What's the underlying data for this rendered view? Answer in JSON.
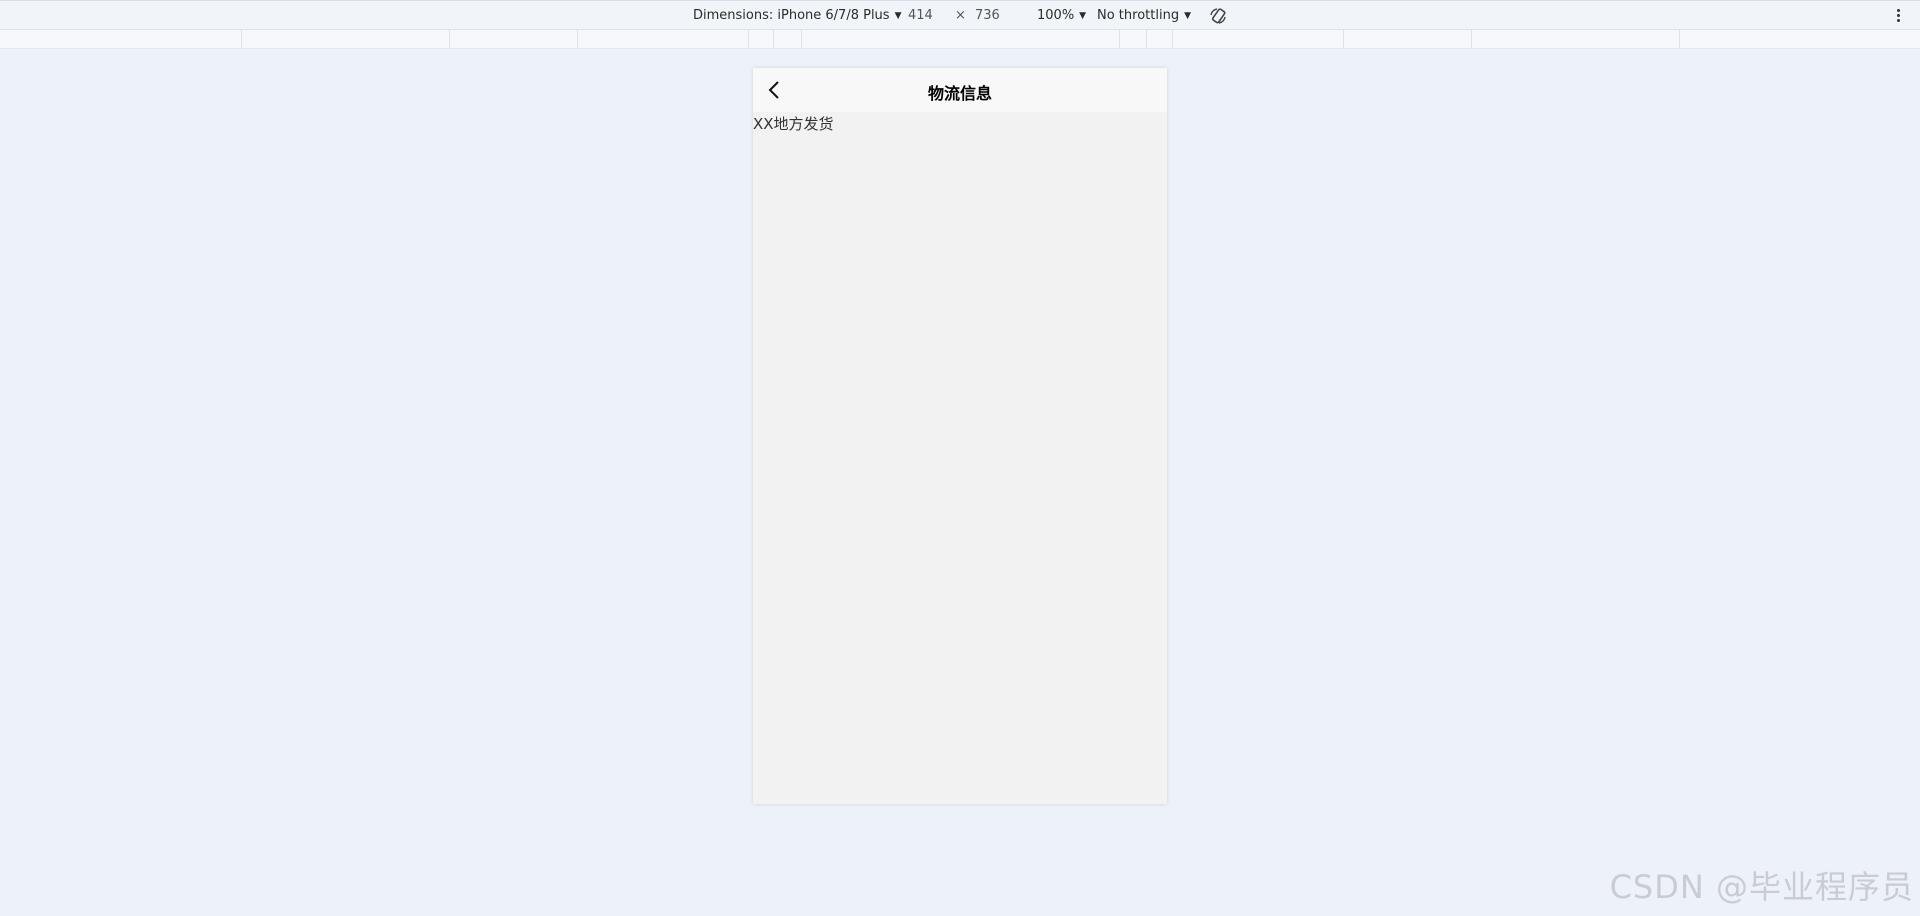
{
  "devtools": {
    "device_label": "Dimensions: iPhone 6/7/8 Plus",
    "width": "414",
    "times": "×",
    "height": "736",
    "zoom": "100%",
    "throttling": "No throttling"
  },
  "app": {
    "title": "物流信息",
    "content": "XX地方发货"
  },
  "watermark": "CSDN @毕业程序员",
  "icons": {
    "back": "chevron-left-icon",
    "rotate": "rotate-icon",
    "more": "kebab-icon"
  }
}
